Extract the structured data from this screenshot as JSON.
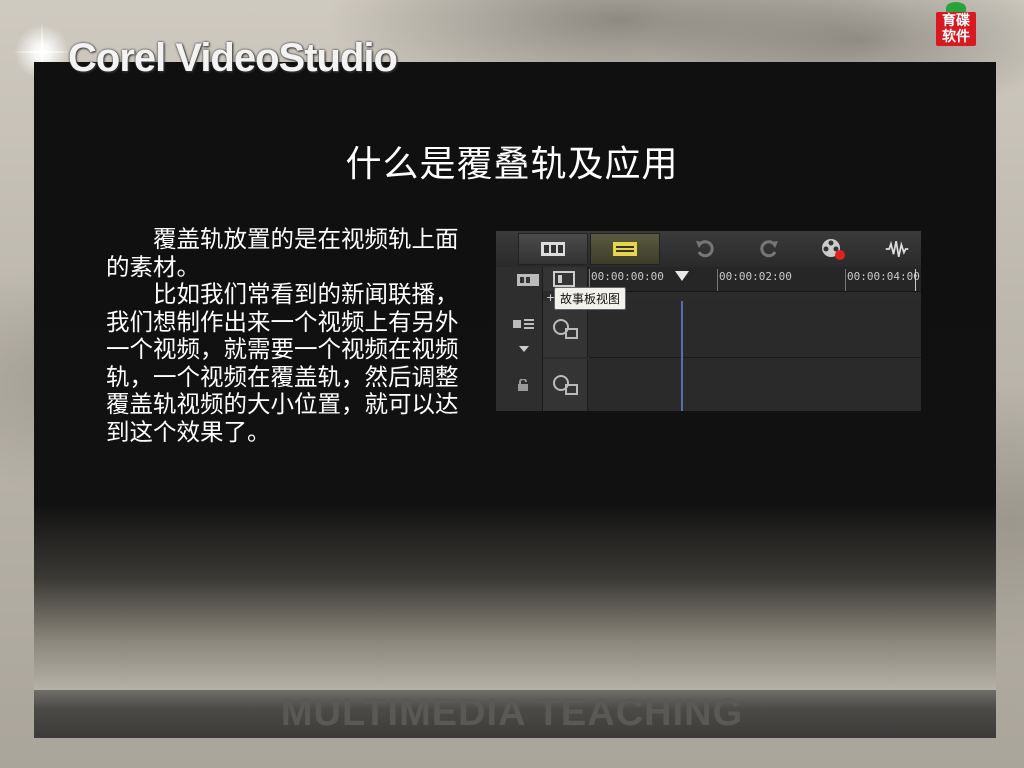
{
  "brand": {
    "app_title": "Corel VideoStudio",
    "logo_text": "育碟软件",
    "logo_text_line1": "育碟",
    "logo_text_line2": "软件"
  },
  "slide": {
    "title": "什么是覆叠轨及应用",
    "paragraphs": [
      "覆盖轨放置的是在视频轨上面的素材。",
      "比如我们常看到的新闻联播，我们想制作出来一个视频上有另外一个视频，就需要一个视频在视频轨，一个视频在覆盖轨，然后调整覆盖轨视频的大小位置，就可以达到这个效果了。"
    ]
  },
  "editor": {
    "toolbar": {
      "storyboard_icon": "film-strip-icon",
      "timeline_icon": "timeline-icon",
      "undo_icon": "undo-icon",
      "redo_icon": "redo-icon",
      "record_icon": "record-capture-icon",
      "audio_icon": "audio-wave-icon"
    },
    "ruler": {
      "times": [
        "00:00:00:00",
        "00:00:02:00",
        "00:00:04:00"
      ]
    },
    "tooltip": "故事板视图",
    "plus": "+"
  },
  "footer": {
    "text": "MULTIMEDIA TEACHING"
  },
  "colors": {
    "panel": "#111111",
    "accent_red": "#d71a20",
    "scrubber": "#5a6fa8"
  }
}
